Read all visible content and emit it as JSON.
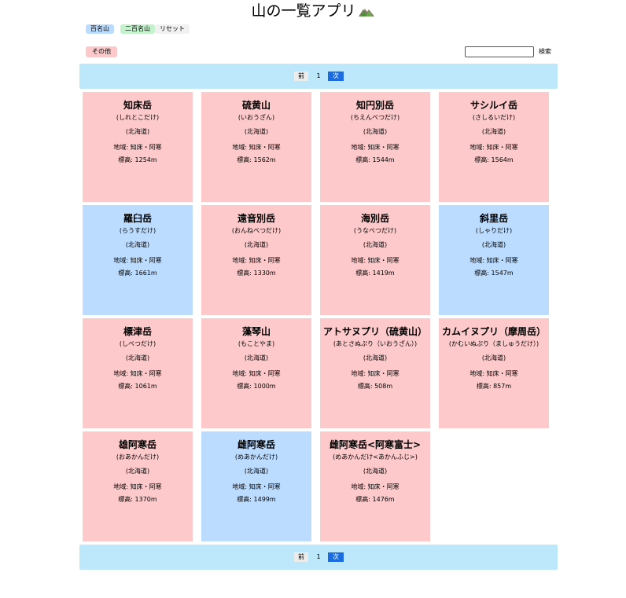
{
  "app": {
    "title": "山の一覧アプリ"
  },
  "filters": {
    "hyakumeizan": "百名山",
    "nihyakumeizan": "二百名山",
    "reset": "リセット",
    "other": "その他"
  },
  "search": {
    "value": "",
    "placeholder": "",
    "button": "検索"
  },
  "pager": {
    "prev": "前",
    "page": "1",
    "next": "次"
  },
  "colors": {
    "pink": "#fec9ca",
    "blue": "#bcdcff",
    "green": "#c3f2cd",
    "pager_bg": "#bde7fb",
    "next_button": "#1a6be0"
  },
  "mountains": [
    {
      "name": "知床岳",
      "kana": "(しれとこだけ)",
      "pref": "(北海道)",
      "area": "地域: 知床・阿寒",
      "elev": "標高: 1254m",
      "color": "pink"
    },
    {
      "name": "硫黄山",
      "kana": "(いおうざん)",
      "pref": "(北海道)",
      "area": "地域: 知床・阿寒",
      "elev": "標高: 1562m",
      "color": "pink"
    },
    {
      "name": "知円別岳",
      "kana": "(ちえんべつだけ)",
      "pref": "(北海道)",
      "area": "地域: 知床・阿寒",
      "elev": "標高: 1544m",
      "color": "pink"
    },
    {
      "name": "サシルイ岳",
      "kana": "(さしるいだけ)",
      "pref": "(北海道)",
      "area": "地域: 知床・阿寒",
      "elev": "標高: 1564m",
      "color": "pink"
    },
    {
      "name": "羅臼岳",
      "kana": "(らうすだけ)",
      "pref": "(北海道)",
      "area": "地域: 知床・阿寒",
      "elev": "標高: 1661m",
      "color": "blue"
    },
    {
      "name": "遠音別岳",
      "kana": "(おんねべつだけ)",
      "pref": "(北海道)",
      "area": "地域: 知床・阿寒",
      "elev": "標高: 1330m",
      "color": "pink"
    },
    {
      "name": "海別岳",
      "kana": "(うなべつだけ)",
      "pref": "(北海道)",
      "area": "地域: 知床・阿寒",
      "elev": "標高: 1419m",
      "color": "pink"
    },
    {
      "name": "斜里岳",
      "kana": "(しゃりだけ)",
      "pref": "(北海道)",
      "area": "地域: 知床・阿寒",
      "elev": "標高: 1547m",
      "color": "blue"
    },
    {
      "name": "標津岳",
      "kana": "(しべつだけ)",
      "pref": "(北海道)",
      "area": "地域: 知床・阿寒",
      "elev": "標高: 1061m",
      "color": "pink"
    },
    {
      "name": "藻琴山",
      "kana": "(もことやま)",
      "pref": "(北海道)",
      "area": "地域: 知床・阿寒",
      "elev": "標高: 1000m",
      "color": "pink"
    },
    {
      "name": "アトサヌプリ（硫黄山）",
      "kana": "(あとさぬぷり（いおうざん）)",
      "pref": "(北海道)",
      "area": "地域: 知床・阿寒",
      "elev": "標高: 508m",
      "color": "pink"
    },
    {
      "name": "カムイヌプリ（摩周岳）",
      "kana": "(かむいぬぷり（ましゅうだけ）)",
      "pref": "(北海道)",
      "area": "地域: 知床・阿寒",
      "elev": "標高: 857m",
      "color": "pink"
    },
    {
      "name": "雄阿寒岳",
      "kana": "(おあかんだけ)",
      "pref": "(北海道)",
      "area": "地域: 知床・阿寒",
      "elev": "標高: 1370m",
      "color": "pink"
    },
    {
      "name": "雌阿寒岳",
      "kana": "(めあかんだけ)",
      "pref": "(北海道)",
      "area": "地域: 知床・阿寒",
      "elev": "標高: 1499m",
      "color": "blue"
    },
    {
      "name": "雌阿寒岳<阿寒富士>",
      "kana": "(めあかんだけ<あかんふじ>)",
      "pref": "(北海道)",
      "area": "地域: 知床・阿寒",
      "elev": "標高: 1476m",
      "color": "pink"
    }
  ]
}
